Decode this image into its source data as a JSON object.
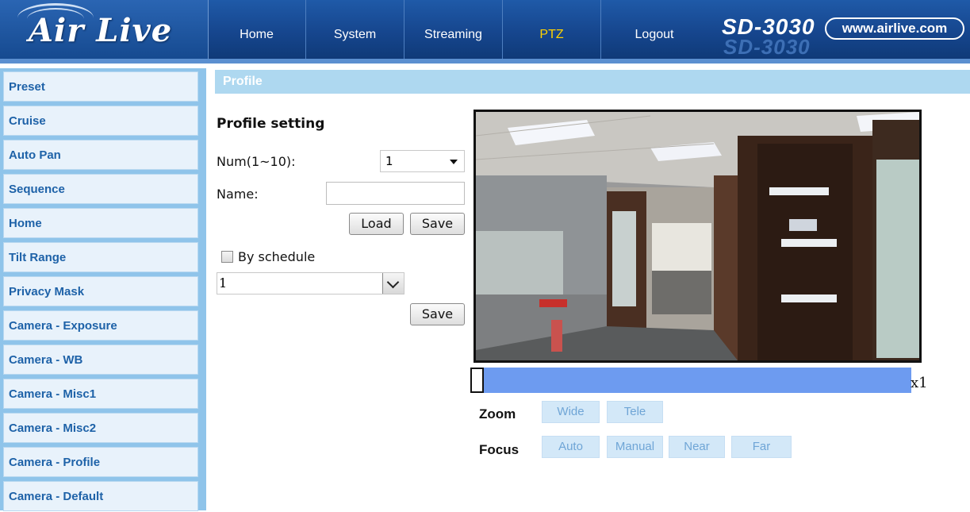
{
  "header": {
    "logo_text": "Air Live",
    "model": "SD-3030",
    "url": "www.airlive.com",
    "nav": [
      {
        "label": "Home"
      },
      {
        "label": "System"
      },
      {
        "label": "Streaming"
      },
      {
        "label": "PTZ",
        "active": true
      },
      {
        "label": "Logout"
      }
    ],
    "active_color": "#ffd200"
  },
  "sidebar": {
    "items": [
      {
        "label": "Preset"
      },
      {
        "label": "Cruise"
      },
      {
        "label": "Auto Pan"
      },
      {
        "label": "Sequence"
      },
      {
        "label": "Home"
      },
      {
        "label": "Tilt Range"
      },
      {
        "label": "Privacy Mask"
      },
      {
        "label": "Camera - Exposure"
      },
      {
        "label": "Camera - WB"
      },
      {
        "label": "Camera - Misc1"
      },
      {
        "label": "Camera - Misc2"
      },
      {
        "label": "Camera - Profile"
      },
      {
        "label": "Camera - Default"
      }
    ]
  },
  "main": {
    "section_title": "Profile",
    "profile_setting_title": "Profile setting",
    "num_label": "Num(1~10):",
    "num_value": "1",
    "name_label": "Name:",
    "name_value": "",
    "load_label": "Load",
    "save_label": "Save",
    "by_schedule_label": "By schedule",
    "by_schedule_checked": false,
    "schedule_value": "1",
    "schedule_save_label": "Save"
  },
  "ptz": {
    "zoom_level": "x1",
    "zoom_label": "Zoom",
    "wide_label": "Wide",
    "tele_label": "Tele",
    "focus_label": "Focus",
    "auto_label": "Auto",
    "manual_label": "Manual",
    "near_label": "Near",
    "far_label": "Far"
  }
}
